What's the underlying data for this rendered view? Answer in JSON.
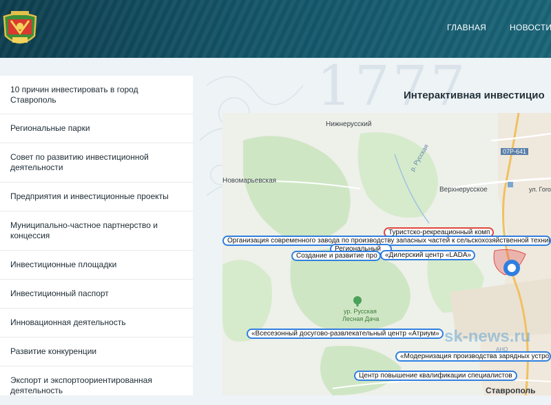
{
  "header": {
    "nav": [
      {
        "label": "ГЛАВНАЯ"
      },
      {
        "label": "НОВОСТИ"
      }
    ]
  },
  "sidebar": {
    "items": [
      {
        "label": "10 причин инвестировать в город Ставрополь"
      },
      {
        "label": "Региональные парки"
      },
      {
        "label": "Совет по развитию инвестиционной деятельности"
      },
      {
        "label": "Предприятия и инвестиционные проекты"
      },
      {
        "label": "Муниципально-частное партнерство и концессия"
      },
      {
        "label": "Инвестиционные площадки"
      },
      {
        "label": "Инвестиционный паспорт"
      },
      {
        "label": "Инновационная деятельность"
      },
      {
        "label": "Развитие конкуренции"
      },
      {
        "label": "Экспорт и экспортоориентированная деятельность"
      }
    ]
  },
  "main": {
    "decor_number": "1777",
    "title": "Интерактивная инвестицио"
  },
  "map": {
    "labels": {
      "nizhnerussky": "Нижнерусский",
      "road": "07Р-641",
      "russkaya_road": "р. Русская",
      "novomaryevskaya": "Новомарьевская",
      "verhnerusskoe": "Верхнерусское",
      "street": "ул. Гогол",
      "park_1": "ур. Русская",
      "park_2": "Лесная Дача",
      "stavropol": "Ставрополь"
    },
    "markers": [
      {
        "text": "Туристско-рекреационный комп",
        "color": "red"
      },
      {
        "text": "Организация современного завода по производству запасных частей к сельскохозяйственной техник",
        "color": "blue"
      },
      {
        "text": "Региональный",
        "color": "blue"
      },
      {
        "text": "Создание и развитие про",
        "color": "blue"
      },
      {
        "text": "«Дилерский центр «LADA»",
        "color": "blue"
      },
      {
        "text": "«Всесезонный досугово-развлекательный центр «Атриум»",
        "color": "blue"
      },
      {
        "text": "«Модернизация производства зарядных устро",
        "color": "blue"
      },
      {
        "text": "Центр повышение квалификации специалистов",
        "color": "blue"
      }
    ],
    "watermark": "sk-news.ru",
    "watermark_sub": "АНО"
  },
  "colors": {
    "header": "#145468",
    "marker_blue": "#2f7fe0",
    "marker_red": "#e0463d",
    "map_green": "#cfe6c4"
  }
}
